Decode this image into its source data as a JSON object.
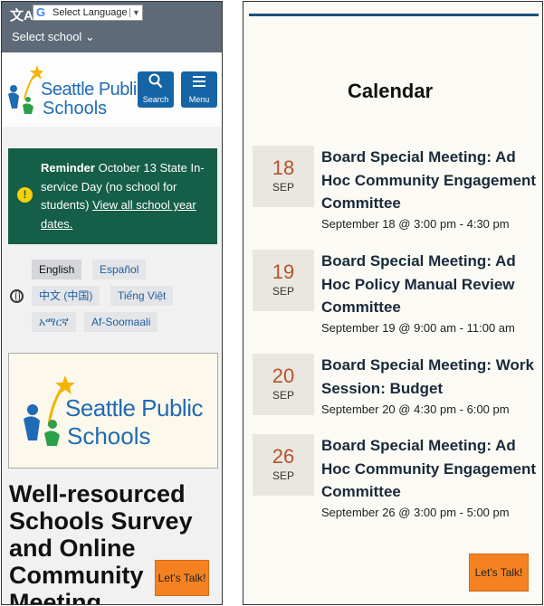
{
  "left": {
    "topbar": {
      "translate_icon": "文A",
      "google_letter": "G",
      "language_select": "Select Language",
      "language_arrow": "▼",
      "select_school": "Select school ⌄"
    },
    "header": {
      "logo_line1": "Seattle Publi",
      "logo_line2": "Schools",
      "search_label": "Search",
      "menu_label": "Menu"
    },
    "reminder": {
      "bold": "Reminder",
      "text": " October 13 State In-service Day (no school for students)  ",
      "link": "View all school year dates.",
      "icon": "!"
    },
    "languages": [
      "English",
      "Español",
      "中文 (中国)",
      "Tiếng Việt",
      "አማርኛ",
      "Af-Soomaali"
    ],
    "logo_box": {
      "line1": "Seattle Public",
      "line2": "Schools"
    },
    "survey_title": "Well-resourced Schools Survey and Online Community Meeting",
    "lets_talk": "Let's Talk!"
  },
  "right": {
    "calendar_title": "Calendar",
    "events": [
      {
        "day": "18",
        "month": "SEP",
        "title": "Board Special Meeting: Ad Hoc Community Engagement Committee",
        "time": "September 18 @ 3:00 pm - 4:30 pm"
      },
      {
        "day": "19",
        "month": "SEP",
        "title": "Board Special Meeting: Ad Hoc Policy Manual Review Committee",
        "time": "September 19 @ 9:00 am - 11:00 am"
      },
      {
        "day": "20",
        "month": "SEP",
        "title": "Board Special Meeting: Work Session: Budget",
        "time": "September 20 @ 4:30 pm - 6:00 pm"
      },
      {
        "day": "26",
        "month": "SEP",
        "title": "Board Special Meeting: Ad Hoc Community Engagement Committee",
        "time": "September 26 @ 3:00 pm - 5:00 pm"
      }
    ],
    "lets_talk": "Let's Talk!"
  },
  "colors": {
    "topbar": "#5e6a78",
    "brand_blue": "#1f6bb5",
    "button_blue": "#1565a6",
    "reminder_green": "#155e48",
    "warning_yellow": "#f5d10a",
    "date_red": "#b5532e",
    "lets_talk_orange": "#f58220"
  }
}
